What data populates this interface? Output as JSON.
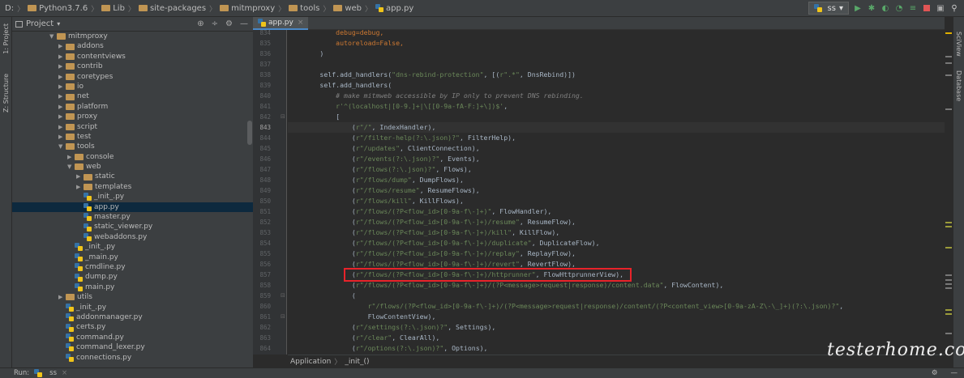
{
  "breadcrumb": {
    "items": [
      "D:",
      "Python3.7.6",
      "Lib",
      "site-packages",
      "mitmproxy",
      "tools",
      "web",
      "app.py"
    ]
  },
  "toolbar": {
    "run_config": "ss"
  },
  "left_stripe": {
    "project": "1: Project",
    "structure": "Z: Structure"
  },
  "right_stripe": {
    "sciview": "SciView",
    "database": "Database"
  },
  "project_panel": {
    "title": "Project"
  },
  "tree": [
    {
      "label": "mitmproxy",
      "type": "folder",
      "depth": 0,
      "open": true
    },
    {
      "label": "addons",
      "type": "folder",
      "depth": 1
    },
    {
      "label": "contentviews",
      "type": "folder",
      "depth": 1
    },
    {
      "label": "contrib",
      "type": "folder",
      "depth": 1
    },
    {
      "label": "coretypes",
      "type": "folder",
      "depth": 1
    },
    {
      "label": "io",
      "type": "folder",
      "depth": 1
    },
    {
      "label": "net",
      "type": "folder",
      "depth": 1
    },
    {
      "label": "platform",
      "type": "folder",
      "depth": 1
    },
    {
      "label": "proxy",
      "type": "folder",
      "depth": 1
    },
    {
      "label": "script",
      "type": "folder",
      "depth": 1
    },
    {
      "label": "test",
      "type": "folder",
      "depth": 1
    },
    {
      "label": "tools",
      "type": "folder",
      "depth": 1,
      "open": true
    },
    {
      "label": "console",
      "type": "folder",
      "depth": 2
    },
    {
      "label": "web",
      "type": "folder",
      "depth": 2,
      "open": true
    },
    {
      "label": "static",
      "type": "folder",
      "depth": 3
    },
    {
      "label": "templates",
      "type": "folder",
      "depth": 3
    },
    {
      "label": "_init_.py",
      "type": "file",
      "depth": 3
    },
    {
      "label": "app.py",
      "type": "file",
      "depth": 3,
      "selected": true
    },
    {
      "label": "master.py",
      "type": "file",
      "depth": 3
    },
    {
      "label": "static_viewer.py",
      "type": "file",
      "depth": 3
    },
    {
      "label": "webaddons.py",
      "type": "file",
      "depth": 3
    },
    {
      "label": "_init_.py",
      "type": "file",
      "depth": 2
    },
    {
      "label": "_main.py",
      "type": "file",
      "depth": 2
    },
    {
      "label": "cmdline.py",
      "type": "file",
      "depth": 2
    },
    {
      "label": "dump.py",
      "type": "file",
      "depth": 2
    },
    {
      "label": "main.py",
      "type": "file",
      "depth": 2
    },
    {
      "label": "utils",
      "type": "folder",
      "depth": 1
    },
    {
      "label": "_init_.py",
      "type": "file",
      "depth": 1
    },
    {
      "label": "addonmanager.py",
      "type": "file",
      "depth": 1
    },
    {
      "label": "certs.py",
      "type": "file",
      "depth": 1
    },
    {
      "label": "command.py",
      "type": "file",
      "depth": 1
    },
    {
      "label": "command_lexer.py",
      "type": "file",
      "depth": 1
    },
    {
      "label": "connections.py",
      "type": "file",
      "depth": 1
    }
  ],
  "editor": {
    "tab": "app.py",
    "current_line": "843",
    "lines": [
      {
        "n": "834",
        "tokens": [
          [
            "            ",
            ""
          ],
          [
            "debug=debug,",
            "kw"
          ]
        ]
      },
      {
        "n": "835",
        "tokens": [
          [
            "            ",
            ""
          ],
          [
            "autoreload=False,",
            "kw"
          ]
        ]
      },
      {
        "n": "836",
        "tokens": [
          [
            "        )",
            ""
          ]
        ]
      },
      {
        "n": "837",
        "tokens": [
          [
            "",
            ""
          ]
        ]
      },
      {
        "n": "838",
        "tokens": [
          [
            "        self.add_handlers(",
            ""
          ],
          [
            "\"dns-rebind-protection\"",
            "st"
          ],
          [
            ", [(",
            ""
          ],
          [
            "r\".*\"",
            "st"
          ],
          [
            ", DnsRebind)])",
            ""
          ]
        ]
      },
      {
        "n": "839",
        "tokens": [
          [
            "        self.add_handlers(",
            ""
          ]
        ]
      },
      {
        "n": "840",
        "tokens": [
          [
            "            ",
            ""
          ],
          [
            "# make mitmweb accessible by IP only to prevent DNS rebinding.",
            "cm"
          ]
        ]
      },
      {
        "n": "841",
        "tokens": [
          [
            "            ",
            ""
          ],
          [
            "r'^(localhost|[0-9.]+|\\[[0-9a-fA-F:]+\\])$'",
            "st"
          ],
          [
            ",",
            ""
          ]
        ]
      },
      {
        "n": "842",
        "tokens": [
          [
            "            [",
            ""
          ]
        ]
      },
      {
        "n": "843",
        "tokens": [
          [
            "                (",
            ""
          ],
          [
            "r\"/\"",
            "st"
          ],
          [
            ", IndexHandler),",
            ""
          ]
        ]
      },
      {
        "n": "844",
        "tokens": [
          [
            "                (",
            ""
          ],
          [
            "r\"/filter-help(?:\\.json)?\"",
            "st"
          ],
          [
            ", FilterHelp),",
            ""
          ]
        ]
      },
      {
        "n": "845",
        "tokens": [
          [
            "                (",
            ""
          ],
          [
            "r\"/updates\"",
            "st"
          ],
          [
            ", ClientConnection),",
            ""
          ]
        ]
      },
      {
        "n": "846",
        "tokens": [
          [
            "                (",
            ""
          ],
          [
            "r\"/events(?:\\.json)?\"",
            "st"
          ],
          [
            ", Events),",
            ""
          ]
        ]
      },
      {
        "n": "847",
        "tokens": [
          [
            "                (",
            ""
          ],
          [
            "r\"/flows(?:\\.json)?\"",
            "st"
          ],
          [
            ", Flows),",
            ""
          ]
        ]
      },
      {
        "n": "848",
        "tokens": [
          [
            "                (",
            ""
          ],
          [
            "r\"/flows/dump\"",
            "st"
          ],
          [
            ", DumpFlows),",
            ""
          ]
        ]
      },
      {
        "n": "849",
        "tokens": [
          [
            "                (",
            ""
          ],
          [
            "r\"/flows/resume\"",
            "st"
          ],
          [
            ", ResumeFlows),",
            ""
          ]
        ]
      },
      {
        "n": "850",
        "tokens": [
          [
            "                (",
            ""
          ],
          [
            "r\"/flows/kill\"",
            "st"
          ],
          [
            ", KillFlows),",
            ""
          ]
        ]
      },
      {
        "n": "851",
        "tokens": [
          [
            "                (",
            ""
          ],
          [
            "r\"/flows/(?P<flow_id>[0-9a-f\\-]+)\"",
            "st"
          ],
          [
            ", FlowHandler),",
            ""
          ]
        ]
      },
      {
        "n": "852",
        "tokens": [
          [
            "                (",
            ""
          ],
          [
            "r\"/flows/(?P<flow_id>[0-9a-f\\-]+)/resume\"",
            "st"
          ],
          [
            ", ResumeFlow),",
            ""
          ]
        ]
      },
      {
        "n": "853",
        "tokens": [
          [
            "                (",
            ""
          ],
          [
            "r\"/flows/(?P<flow_id>[0-9a-f\\-]+)/kill\"",
            "st"
          ],
          [
            ", KillFlow),",
            ""
          ]
        ]
      },
      {
        "n": "854",
        "tokens": [
          [
            "                (",
            ""
          ],
          [
            "r\"/flows/(?P<flow_id>[0-9a-f\\-]+)/duplicate\"",
            "st"
          ],
          [
            ", DuplicateFlow),",
            ""
          ]
        ]
      },
      {
        "n": "855",
        "tokens": [
          [
            "                (",
            ""
          ],
          [
            "r\"/flows/(?P<flow_id>[0-9a-f\\-]+)/replay\"",
            "st"
          ],
          [
            ", ReplayFlow),",
            ""
          ]
        ]
      },
      {
        "n": "856",
        "tokens": [
          [
            "                (",
            ""
          ],
          [
            "r\"/flows/(?P<flow_id>[0-9a-f\\-]+)/revert\"",
            "st"
          ],
          [
            ", RevertFlow),",
            ""
          ]
        ]
      },
      {
        "n": "857",
        "tokens": [
          [
            "                (",
            ""
          ],
          [
            "r\"/flows/(?P<flow_id>[0-9a-f\\-]+)/httprunner\"",
            "st"
          ],
          [
            ", FlowHttprunnerView),",
            ""
          ]
        ]
      },
      {
        "n": "858",
        "tokens": [
          [
            "                (",
            ""
          ],
          [
            "r\"/flows/(?P<flow_id>[0-9a-f\\-]+)/(?P<message>request|response)/content.data\"",
            "st"
          ],
          [
            ", FlowContent),",
            ""
          ]
        ]
      },
      {
        "n": "859",
        "tokens": [
          [
            "                (",
            ""
          ]
        ]
      },
      {
        "n": "860",
        "tokens": [
          [
            "                    ",
            ""
          ],
          [
            "r\"/flows/(?P<flow_id>[0-9a-f\\-]+)/(?P<message>request|response)/content/(?P<content_view>[0-9a-zA-Z\\-\\_]+)(?:\\.json)?\"",
            "st"
          ],
          [
            ",",
            ""
          ]
        ]
      },
      {
        "n": "861",
        "tokens": [
          [
            "                    FlowContentView),",
            ""
          ]
        ]
      },
      {
        "n": "862",
        "tokens": [
          [
            "                (",
            ""
          ],
          [
            "r\"/settings(?:\\.json)?\"",
            "st"
          ],
          [
            ", Settings),",
            ""
          ]
        ]
      },
      {
        "n": "863",
        "tokens": [
          [
            "                (",
            ""
          ],
          [
            "r\"/clear\"",
            "st"
          ],
          [
            ", ClearAll),",
            ""
          ]
        ]
      },
      {
        "n": "864",
        "tokens": [
          [
            "                (",
            ""
          ],
          [
            "r\"/options(?:\\.json)?\"",
            "st"
          ],
          [
            ", Options),",
            ""
          ]
        ]
      }
    ],
    "crumbs": [
      "Application",
      "_init_()"
    ]
  },
  "status": {
    "run_label": "Run:",
    "run_tab": "ss"
  },
  "watermark": "testerhome.com",
  "colors": {
    "accent": "#4a88c7",
    "highlight_box": "#e8232a",
    "selection": "#0d293e"
  }
}
